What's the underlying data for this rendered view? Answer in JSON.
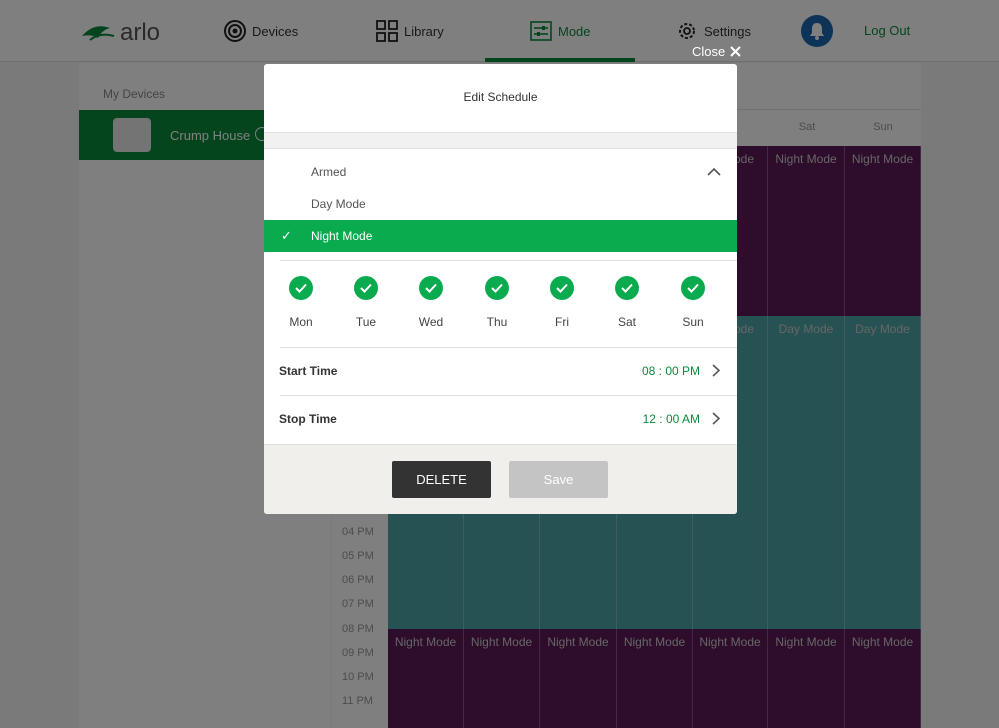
{
  "header": {
    "nav": {
      "devices": "Devices",
      "library": "Library",
      "mode": "Mode",
      "settings": "Settings"
    },
    "logout": "Log Out"
  },
  "left_panel": {
    "title": "My Devices",
    "device_name": "Crump House"
  },
  "schedule": {
    "days_visible": [
      "Sat",
      "Sun"
    ],
    "time_labels": [
      "04 PM",
      "05 PM",
      "06 PM",
      "07 PM",
      "08 PM",
      "09 PM",
      "10 PM",
      "11 PM"
    ],
    "night_label": "Night Mode",
    "day_label": "Day Mode",
    "partial_label": "ode"
  },
  "overlay": {
    "close_label": "Close"
  },
  "modal": {
    "title": "Edit Schedule",
    "mode_options": [
      "Armed",
      "Day Mode",
      "Night Mode"
    ],
    "selected_mode": "Night Mode",
    "days": [
      "Mon",
      "Tue",
      "Wed",
      "Thu",
      "Fri",
      "Sat",
      "Sun"
    ],
    "start_time_label": "Start Time",
    "start_time_value": "08 : 00 PM",
    "stop_time_label": "Stop Time",
    "stop_time_value": "12 : 00 AM",
    "delete_label": "DELETE",
    "save_label": "Save"
  },
  "colors": {
    "brand_green": "#0a8a3c",
    "selected_green": "#0aaa4f",
    "night_block": "#5a1a56",
    "day_block": "#4fa4a8",
    "bell_blue": "#1a68b0"
  }
}
